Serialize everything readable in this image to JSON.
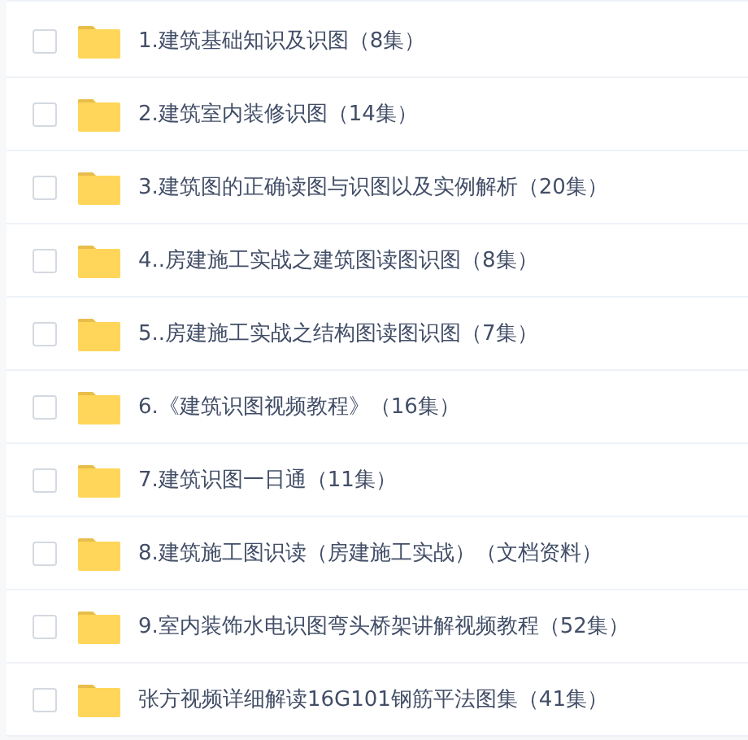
{
  "files": [
    {
      "name": "1.建筑基础知识及识图（8集）",
      "checked": false
    },
    {
      "name": "2.建筑室内装修识图（14集）",
      "checked": false
    },
    {
      "name": "3.建筑图的正确读图与识图以及实例解析（20集）",
      "checked": false
    },
    {
      "name": "4..房建施工实战之建筑图读图识图（8集）",
      "checked": false
    },
    {
      "name": "5..房建施工实战之结构图读图识图（7集）",
      "checked": false
    },
    {
      "name": "6.《建筑识图视频教程》（16集）",
      "checked": false
    },
    {
      "name": "7.建筑识图一日通（11集）",
      "checked": false
    },
    {
      "name": "8.建筑施工图识读（房建施工实战）（文档资料）",
      "checked": false
    },
    {
      "name": "9.室内装饰水电识图弯头桥架讲解视频教程（52集）",
      "checked": false
    },
    {
      "name": "张方视频详细解读16G101钢筋平法图集（41集）",
      "checked": false
    }
  ]
}
